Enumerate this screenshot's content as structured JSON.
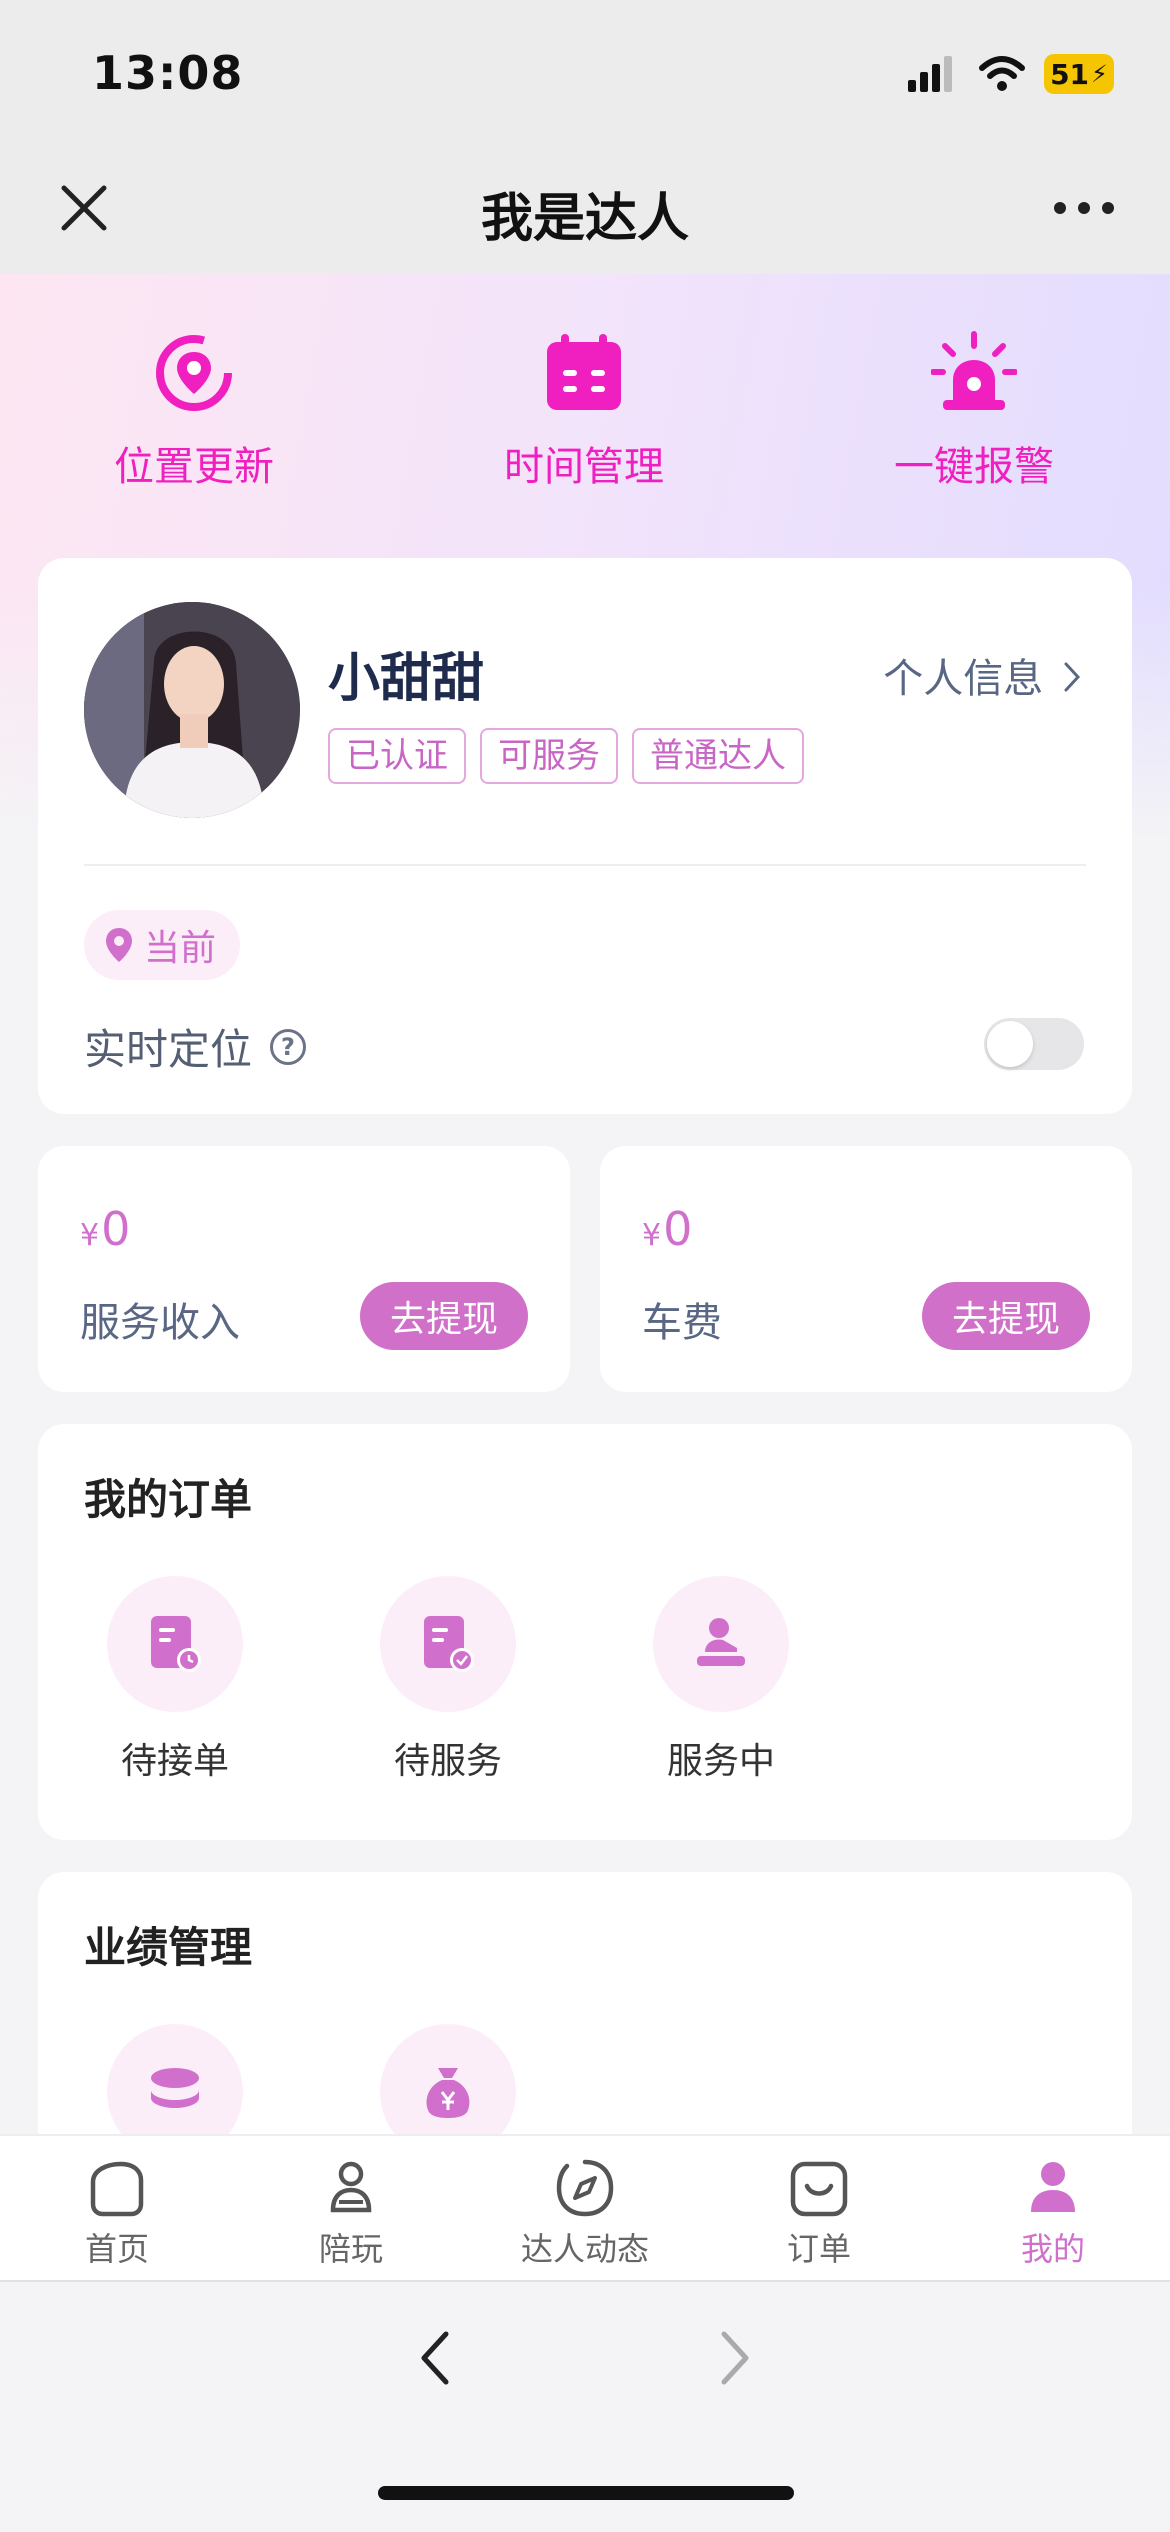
{
  "status_bar": {
    "time": "13:08",
    "battery": "51"
  },
  "nav": {
    "title": "我是达人"
  },
  "quick_actions": [
    {
      "label": "位置更新",
      "icon": "location-refresh-icon"
    },
    {
      "label": "时间管理",
      "icon": "calendar-icon"
    },
    {
      "label": "一键报警",
      "icon": "alarm-icon"
    }
  ],
  "profile": {
    "name": "小甜甜",
    "info_link": "个人信息",
    "tags": [
      "已认证",
      "可服务",
      "普通达人"
    ],
    "location_badge": "当前",
    "realtime_location_label": "实时定位",
    "realtime_location_on": false
  },
  "wallet": [
    {
      "currency": "¥",
      "amount": "0",
      "label": "服务收入",
      "button": "去提现"
    },
    {
      "currency": "¥",
      "amount": "0",
      "label": "车费",
      "button": "去提现"
    }
  ],
  "orders": {
    "title": "我的订单",
    "items": [
      {
        "label": "待接单",
        "icon": "pending-order-icon"
      },
      {
        "label": "待服务",
        "icon": "to-serve-icon"
      },
      {
        "label": "服务中",
        "icon": "in-service-icon"
      }
    ]
  },
  "performance": {
    "title": "业绩管理",
    "items": [
      {
        "icon": "coins-icon"
      },
      {
        "icon": "money-bag-icon"
      }
    ]
  },
  "tabbar": [
    {
      "label": "首页",
      "icon": "home-icon",
      "active": false
    },
    {
      "label": "陪玩",
      "icon": "companion-icon",
      "active": false
    },
    {
      "label": "达人动态",
      "icon": "compass-icon",
      "active": false
    },
    {
      "label": "订单",
      "icon": "order-bag-icon",
      "active": false
    },
    {
      "label": "我的",
      "icon": "profile-icon",
      "active": true
    }
  ],
  "colors": {
    "accent": "#d070cc",
    "quick_action": "#f020c0",
    "name": "#1e2b4d"
  }
}
